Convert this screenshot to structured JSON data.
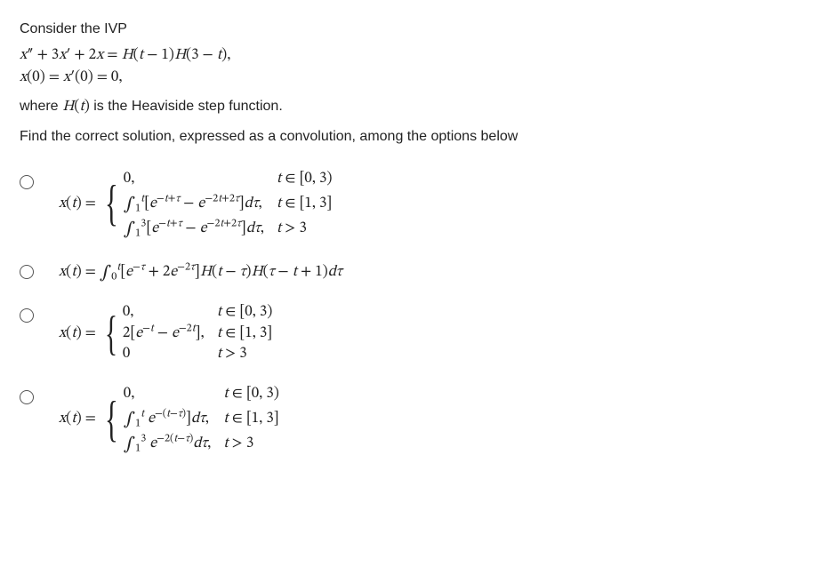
{
  "intro": "Consider the IVP",
  "ode_line1": "x″ + 3x′ + 2x = H(t − 1)H(3 − t),",
  "ode_line2": "x(0) = x′(0) = 0,",
  "heaviside_note_pre": "where ",
  "heaviside_note_fn": "H(t)",
  "heaviside_note_post": " is the Heaviside step function.",
  "prompt": "Find the correct solution, expressed as a convolution, among the options below",
  "xeq": "x(t) = ",
  "options": {
    "a": {
      "c1_expr": "0,",
      "c1_cond": "t ∈ [0, 3)",
      "c2_expr": "∫₁ᵗ [e⁻ᵗ⁺ᵗ − e⁻²ᵗ⁺²ᵗ]dτ,",
      "c2_cond": "t ∈ [1, 3]",
      "c3_expr": "∫₁³ [e⁻ᵗ⁺ᵗ − e⁻²ᵗ⁺²ᵗ]dτ,",
      "c3_cond": "t > 3"
    },
    "b": {
      "expr": "x(t) = ∫₀ᵗ [e⁻ᵗ + 2e⁻²ᵗ]H(t − τ)H(τ − t + 1)dτ"
    },
    "c": {
      "c1_expr": "0,",
      "c1_cond": "t ∈ [0, 3)",
      "c2_expr": "2[e⁻ᵗ − e⁻²ᵗ],",
      "c2_cond": "t ∈ [1, 3]",
      "c3_expr": "0",
      "c3_cond": "t > 3"
    },
    "d": {
      "c1_expr": "0,",
      "c1_cond": "t ∈ [0, 3)",
      "c2_expr": "∫₁ᵗ e⁻(ᵗ⁻ᵗ)]dτ,",
      "c2_cond": "t ∈ [1, 3]",
      "c3_expr": "∫₁³ e⁻²(ᵗ⁻ᵗ)dτ,",
      "c3_cond": "t > 3"
    }
  }
}
